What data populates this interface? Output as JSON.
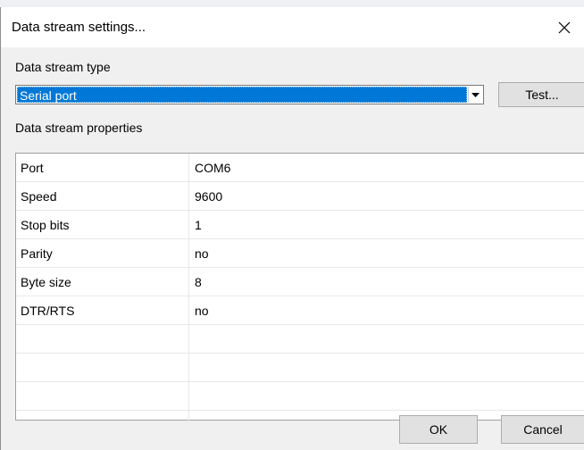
{
  "window": {
    "title": "Data stream settings...",
    "close_icon": "close-icon"
  },
  "stream_type": {
    "label": "Data stream type",
    "selected": "Serial port",
    "test_button": "Test..."
  },
  "properties": {
    "label": "Data stream properties",
    "rows": [
      {
        "name": "Port",
        "value": "COM6"
      },
      {
        "name": "Speed",
        "value": "9600"
      },
      {
        "name": "Stop bits",
        "value": "1"
      },
      {
        "name": "Parity",
        "value": "no"
      },
      {
        "name": "Byte size",
        "value": "8"
      },
      {
        "name": "DTR/RTS",
        "value": "no"
      },
      {
        "name": "",
        "value": ""
      },
      {
        "name": "",
        "value": ""
      },
      {
        "name": "",
        "value": ""
      }
    ]
  },
  "footer": {
    "ok_button": "OK",
    "cancel_button": "Cancel"
  },
  "colors": {
    "selection": "#0078d7",
    "dialog_bg": "#f0f0f0",
    "button_bg": "#e1e1e1"
  }
}
